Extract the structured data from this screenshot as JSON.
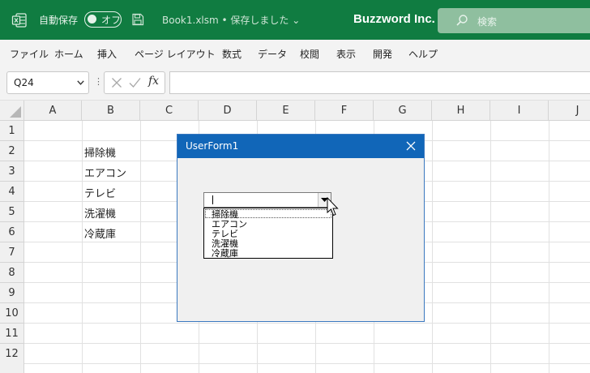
{
  "titlebar": {
    "autosave_label": "自動保存",
    "autosave_state": "オフ",
    "filename": "Book1.xlsm • 保存しました ⌄",
    "company": "Buzzword Inc.",
    "search_placeholder": "検索",
    "brand_color": "#107c41"
  },
  "menu": {
    "items": [
      "ファイル",
      "ホーム",
      "挿入",
      "ページ レイアウト",
      "数式",
      "データ",
      "校閲",
      "表示",
      "開発",
      "ヘルプ"
    ]
  },
  "formula_bar": {
    "name_box": "Q24",
    "more_dots": "⋮",
    "fx_label": "fx",
    "formula_value": ""
  },
  "grid": {
    "columns": [
      "A",
      "B",
      "C",
      "D",
      "E",
      "F",
      "G",
      "H",
      "I",
      "J"
    ],
    "rows": [
      "1",
      "2",
      "3",
      "4",
      "5",
      "6",
      "7",
      "8",
      "9",
      "10",
      "11",
      "12"
    ],
    "cells_B": [
      "掃除機",
      "エアコン",
      "テレビ",
      "洗濯機",
      "冷蔵庫"
    ]
  },
  "userform": {
    "title": "UserForm1",
    "title_color": "#1166b8",
    "combo_value": "",
    "dropdown_items": [
      "掃除機",
      "エアコン",
      "テレビ",
      "洗濯機",
      "冷蔵庫"
    ]
  }
}
